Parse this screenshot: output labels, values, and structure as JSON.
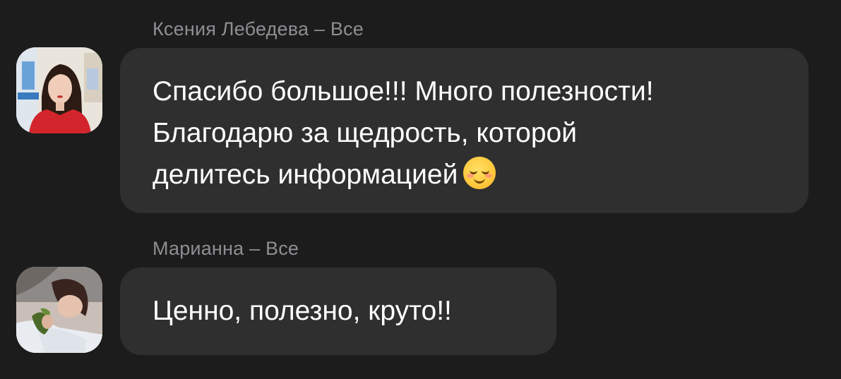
{
  "messages": [
    {
      "sender": "Ксения Лебедева – Все",
      "text": "Спасибо большое!!! Много полезности!\nБлагодарю за щедрость, которой\nделитесь информацией",
      "emoji": "smiling-face-emoji"
    },
    {
      "sender": "Марианна – Все",
      "text": "Ценно, полезно, круто!!"
    }
  ],
  "colors": {
    "background": "#1c1c1c",
    "bubble": "#2f2f2f",
    "sender_text": "#8e8e93",
    "message_text": "#ffffff"
  }
}
